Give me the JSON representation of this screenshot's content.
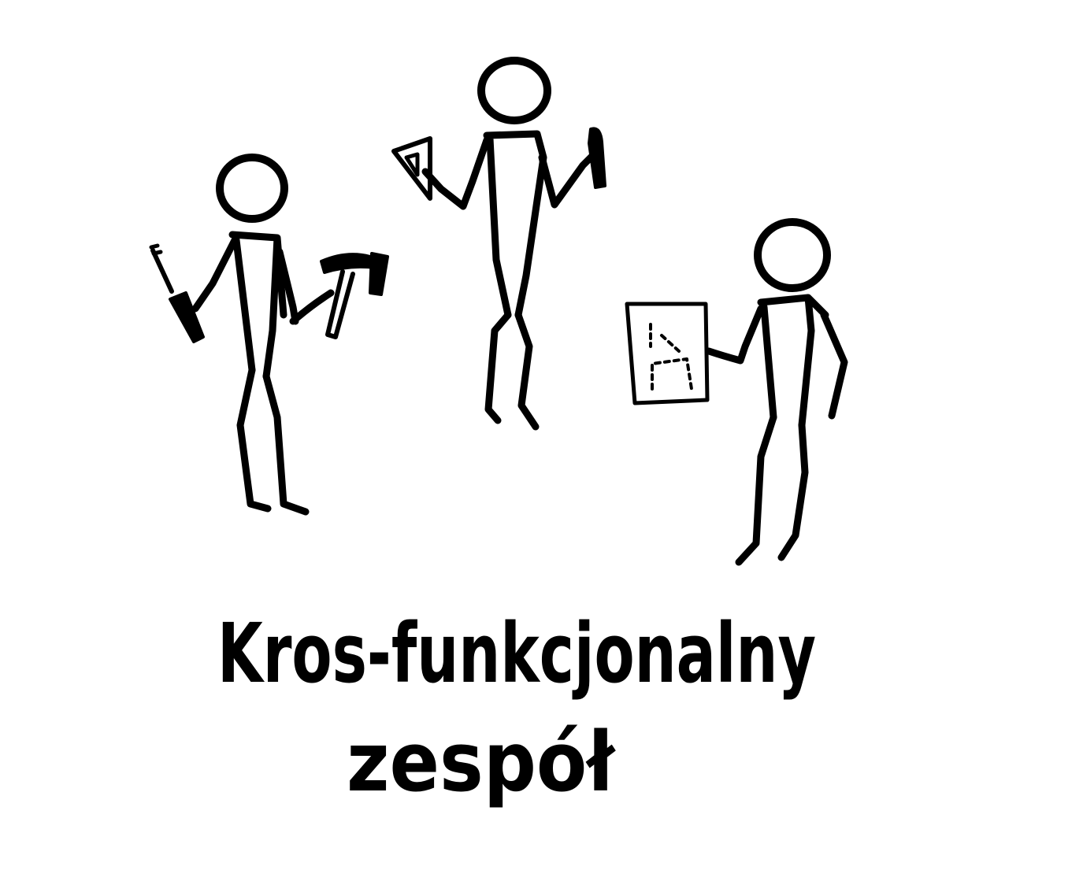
{
  "caption": {
    "line1": "Kros-funkcjonalny",
    "line2": "zespół"
  },
  "figures": [
    {
      "role": "builder",
      "tools": [
        "screwdriver-icon",
        "hammer-icon"
      ]
    },
    {
      "role": "designer",
      "tools": [
        "set-square-icon",
        "marker-icon"
      ]
    },
    {
      "role": "planner",
      "tools": [
        "blueprint-sheet-icon"
      ]
    }
  ],
  "colors": {
    "ink": "#000000",
    "background": "#ffffff"
  }
}
